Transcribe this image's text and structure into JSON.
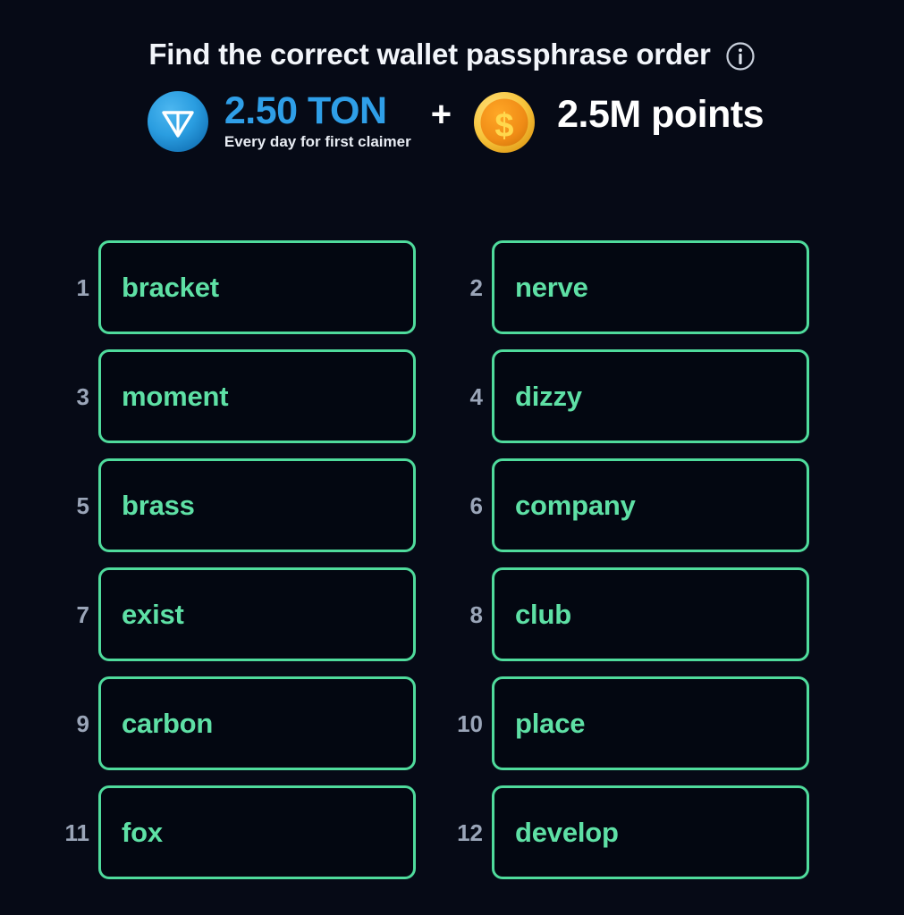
{
  "header": {
    "title": "Find the correct wallet passphrase order",
    "info_icon": "info-circle-icon"
  },
  "reward": {
    "ton_icon": "ton-coin-icon",
    "ton_amount": "2.50 TON",
    "ton_note": "Every day for first claimer",
    "plus": "+",
    "points_icon": "gold-coin-dollar-icon",
    "points_amount": "2.5M points"
  },
  "colors": {
    "background": "#060a16",
    "box_border": "#4fdb9c",
    "box_fill": "#030711",
    "word_text": "#5ee0a5",
    "index_text": "#9aa5b8",
    "ton_blue": "#2f9fe8",
    "coin_gold": "#f5a623",
    "title_text": "#f2f5fa"
  },
  "words": [
    {
      "index": "1",
      "word": "bracket"
    },
    {
      "index": "2",
      "word": "nerve"
    },
    {
      "index": "3",
      "word": "moment"
    },
    {
      "index": "4",
      "word": "dizzy"
    },
    {
      "index": "5",
      "word": "brass"
    },
    {
      "index": "6",
      "word": "company"
    },
    {
      "index": "7",
      "word": "exist"
    },
    {
      "index": "8",
      "word": "club"
    },
    {
      "index": "9",
      "word": "carbon"
    },
    {
      "index": "10",
      "word": "place"
    },
    {
      "index": "11",
      "word": "fox"
    },
    {
      "index": "12",
      "word": "develop"
    }
  ]
}
